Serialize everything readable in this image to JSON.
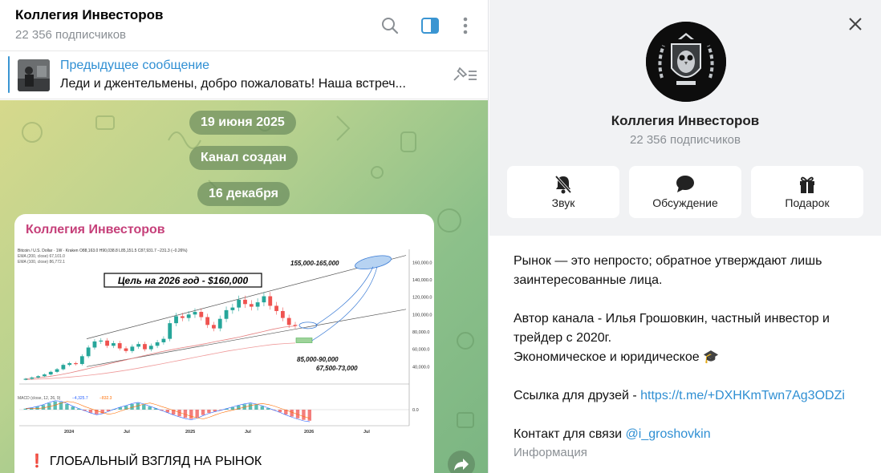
{
  "header": {
    "channel_title": "Коллегия Инвесторов",
    "subscribers": "22 356 подписчиков"
  },
  "pinned": {
    "title": "Предыдущее сообщение",
    "text": "Леди и джентельмены, добро пожаловать!  Наша встреч..."
  },
  "feed": {
    "date_pill_1": "19 июня 2025",
    "service_message": "Канал создан",
    "date_pill_2": "16 декабря",
    "message": {
      "author": "Коллегия Инвесторов",
      "caption_emoji": "❗",
      "caption": "ГЛОБАЛЬНЫЙ ВЗГЛЯД НА РЫНОК"
    }
  },
  "chart_data": {
    "type": "line",
    "header_line": "Bitcoin / U.S. Dollar · 1W · Kraken  O88,163.0  H90,038.8  L85,151.5  C87,931.7  −231.3 (−0.26%)",
    "ema200_label": "EMA (200, close)  67,101.0",
    "ema100_label": "EMA (100, close)  86,772.1",
    "goal_label": "Цель на 2026 год - $160,000",
    "annotations": [
      "155,000-165,000",
      "85,000-90,000",
      "67,500-73,000"
    ],
    "macd_label": "MACD (close, 12, 26, 9)",
    "macd_values": [
      "−4,325.7",
      "−832.3"
    ],
    "y_ticks": [
      "160,000.0",
      "140,000.0",
      "120,000.0",
      "100,000.0",
      "80,000.0",
      "60,000.0",
      "40,000.0"
    ],
    "macd_tick": "0.0",
    "x_ticks": [
      "2024",
      "Jul",
      "2025",
      "Jul",
      "2026",
      "Jul"
    ],
    "ylim": [
      20000,
      175000
    ],
    "series": [
      {
        "values": [
          26000,
          27500,
          29000,
          31000,
          34000,
          37000,
          42000,
          44000,
          43000,
          52000,
          62000,
          69000,
          70000,
          64000,
          67000,
          61000,
          58000,
          63000,
          66000,
          60000,
          64000,
          68000,
          72000,
          90000,
          98000,
          96000,
          100000,
          103000,
          97000,
          88000,
          84000,
          95000,
          105000,
          108000,
          117000,
          112000,
          109000,
          114000,
          121000,
          110000,
          104000,
          96000,
          88000,
          87500
        ]
      }
    ],
    "ema_series": [
      {
        "values": [
          26000,
          27000,
          28500,
          30500,
          33000,
          36000,
          39000,
          42000,
          45000,
          48000,
          51000,
          54000,
          57000,
          59500,
          62000,
          64000,
          66500,
          69000,
          71500,
          74000,
          77000,
          80000,
          83000,
          85500,
          86800
        ]
      },
      {
        "values": [
          25000,
          25500,
          26200,
          27000,
          28000,
          29200,
          30600,
          32200,
          34000,
          36000,
          38200,
          40600,
          43000,
          45500,
          48000,
          50500,
          53000,
          55500,
          58000,
          60000,
          62000,
          63800,
          65500,
          66500,
          67100
        ]
      }
    ],
    "macd_series": [
      {
        "values": [
          400,
          700,
          1200,
          1800,
          2600,
          3200,
          3000,
          2200,
          1200,
          400,
          -400,
          -1200,
          -1800,
          -1400,
          -600,
          200,
          900,
          1500,
          2200,
          2600,
          2000,
          1200,
          500,
          -300,
          -1100,
          -1900,
          -2600,
          -3200,
          -3600,
          -3000,
          -2100,
          -1300,
          -700,
          -200,
          400,
          1000,
          1600,
          2100,
          2400,
          2000,
          1400,
          600,
          -200,
          -1000,
          -1900,
          -2700,
          -3400,
          -4000,
          -4325
        ]
      }
    ]
  },
  "info": {
    "title": "Коллегия Инвесторов",
    "subscribers": "22 356 подписчиков",
    "actions": [
      {
        "label": "Звук",
        "icon": "bell-off-icon"
      },
      {
        "label": "Обсуждение",
        "icon": "chat-bubble-icon"
      },
      {
        "label": "Подарок",
        "icon": "gift-icon"
      }
    ],
    "about_line_1": "Рынок — это непросто; обратное утверждают лишь заинтересованные лица.",
    "about_line_2": "Автор канала - Илья Грошовкин, частный инвестор и трейдер с 2020г.",
    "about_line_3": "Экономическое и юридическое",
    "about_line_3_emoji": "🎓",
    "link_prefix": "Ссылка для друзей - ",
    "link": "https://t.me/+DXHKmTwn7Ag3ODZi",
    "contact_prefix": "Контакт для связи ",
    "contact": "@i_groshovkin",
    "section_label": "Информация"
  },
  "colors": {
    "accent": "#2f8fd3",
    "author": "#c6407a",
    "candle_up": "#26a69a",
    "candle_down": "#ef5350",
    "goal_zone": "#b7d3f2",
    "support_zone": "#9ed39a"
  }
}
